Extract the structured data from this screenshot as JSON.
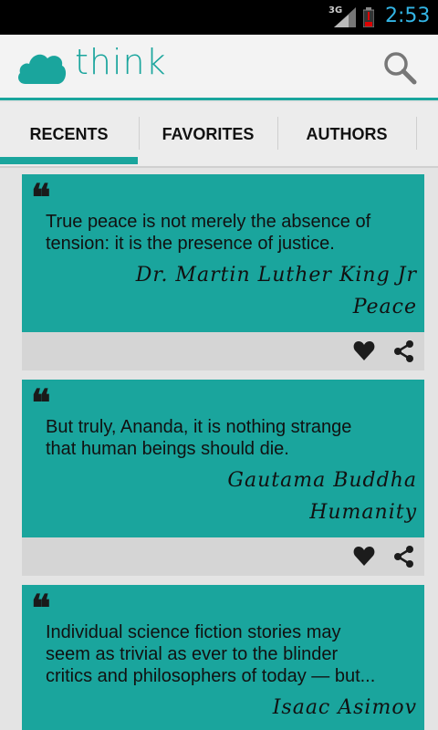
{
  "status_bar": {
    "network": "3G",
    "time": "2:53",
    "time_color": "#33b5e5"
  },
  "header": {
    "app_name": "think",
    "brand_color": "#1aa59d",
    "logo_icon": "cloud-icon",
    "search_icon": "search-icon"
  },
  "tabs": [
    {
      "label": "RECENTS",
      "selected": true
    },
    {
      "label": "FAVORITES",
      "selected": false
    },
    {
      "label": "AUTHORS",
      "selected": false
    }
  ],
  "quotes": [
    {
      "mark": "❝",
      "text_lines": [
        "True peace is not merely the absence of",
        "tension: it is the presence of justice."
      ],
      "author": "Dr. Martin Luther King Jr",
      "topic": "Peace"
    },
    {
      "mark": "❝",
      "text_lines": [
        "But truly, Ananda, it is nothing strange",
        "that human beings should die."
      ],
      "author": "Gautama Buddha",
      "topic": "Humanity"
    },
    {
      "mark": "❝",
      "text_lines": [
        "Individual science fiction stories may",
        "seem as trivial as ever to the blinder",
        "critics and philosophers of today — but..."
      ],
      "author": "Isaac Asimov",
      "topic": ""
    }
  ],
  "card_actions": {
    "favorite_icon": "heart-icon",
    "share_icon": "share-icon"
  }
}
